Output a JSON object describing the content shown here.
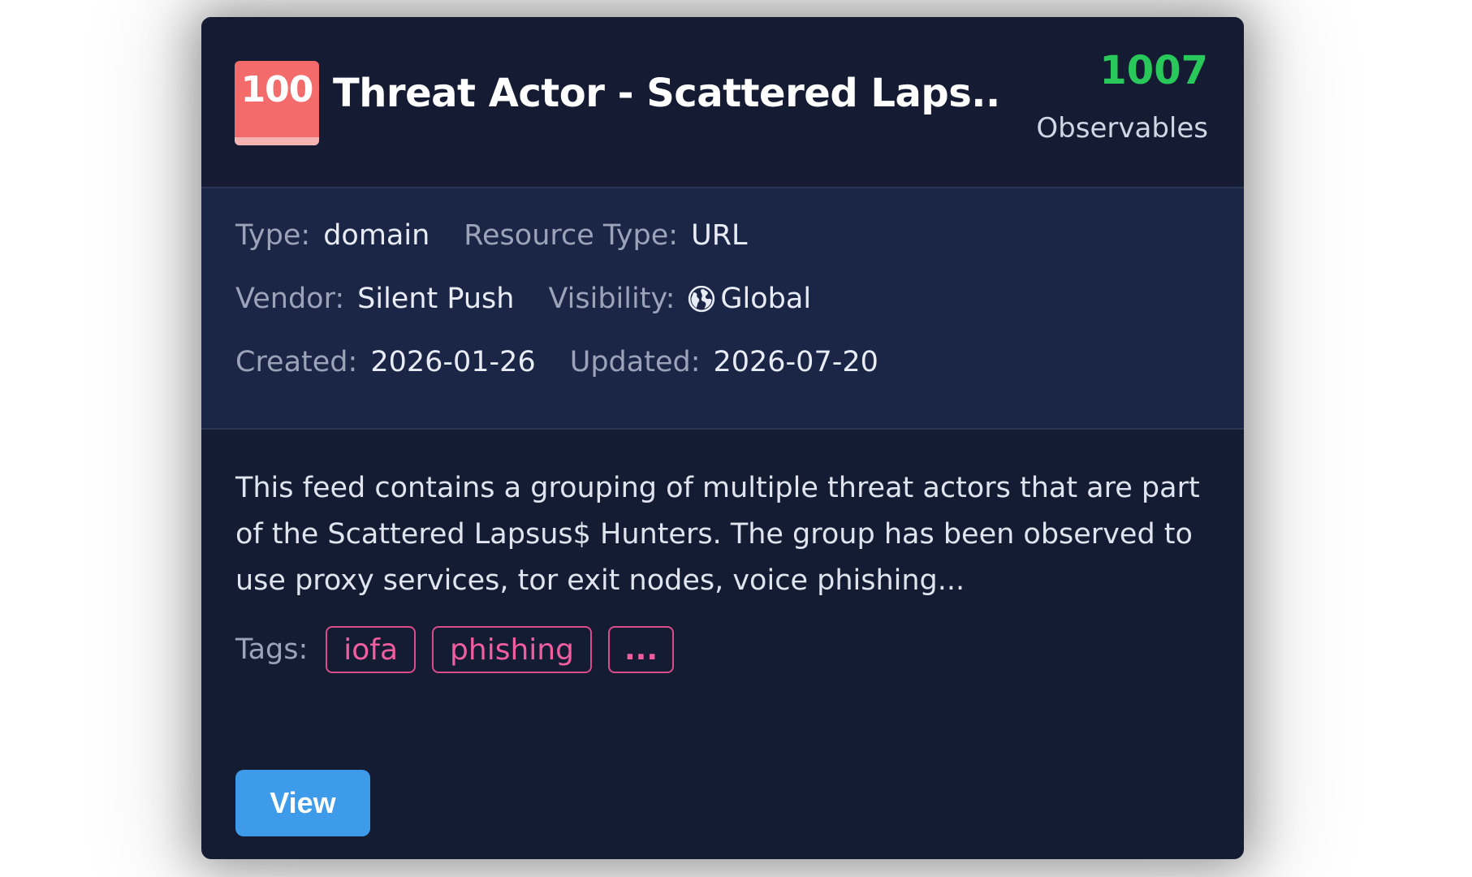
{
  "card": {
    "score": "100",
    "title": "Threat Actor - Scattered Laps...",
    "observables_count": "1007",
    "observables_label": "Observables",
    "meta": {
      "type_label": "Type:",
      "type_value": "domain",
      "resource_type_label": "Resource Type:",
      "resource_type_value": "URL",
      "vendor_label": "Vendor:",
      "vendor_value": "Silent Push",
      "visibility_label": "Visibility:",
      "visibility_value": "Global",
      "created_label": "Created:",
      "created_value": "2026-01-26",
      "updated_label": "Updated:",
      "updated_value": "2026-07-20"
    },
    "description": "This feed contains a grouping of multiple threat actors that are part of the Scattered Lapsus$ Hunters. The group has been observed to use proxy services, tor exit nodes, voice phishing...",
    "tags_label": "Tags:",
    "tags": [
      "iofa",
      "phishing",
      "..."
    ],
    "view_label": "View"
  },
  "icons": {
    "visibility": "globe-icon"
  },
  "colors": {
    "card_bg": "#141c33",
    "meta_bg": "#1b2545",
    "score_badge": "#f46b6b",
    "observables_count": "#28c95a",
    "tag_border": "#d94b8c",
    "tag_text": "#f05ea0",
    "view_button": "#3d9be9"
  }
}
